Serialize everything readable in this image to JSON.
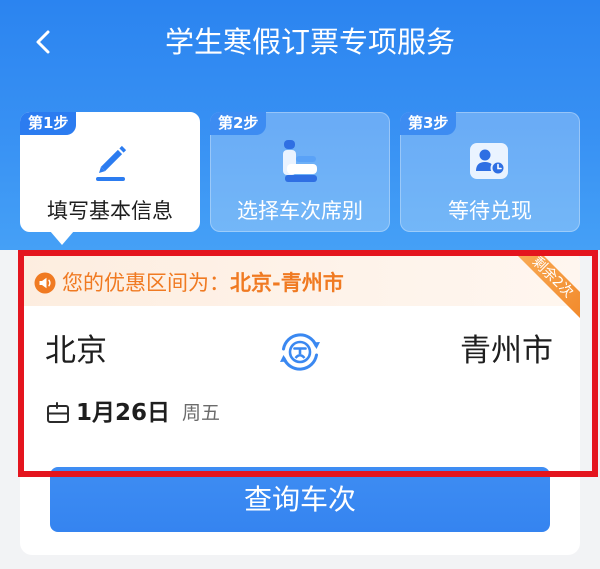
{
  "header": {
    "title": "学生寒假订票专项服务",
    "back_icon": "chevron-left-icon"
  },
  "steps": [
    {
      "badge": "第1步",
      "label": "填写基本信息",
      "icon": "pen-icon",
      "active": true
    },
    {
      "badge": "第2步",
      "label": "选择车次席别",
      "icon": "seat-icon",
      "active": false
    },
    {
      "badge": "第3步",
      "label": "等待兑现",
      "icon": "ticket-user-icon",
      "active": false
    }
  ],
  "booking": {
    "notice_icon": "megaphone-icon",
    "notice_prefix": "您的优惠区间为：",
    "notice_route": "北京-青州市",
    "ribbon": "剩余2次",
    "from_station": "北京",
    "to_station": "青州市",
    "swap_icon": "swap-stations-icon",
    "date_icon": "calendar-icon",
    "date": "1月26日",
    "weekday": "周五"
  },
  "search_button": {
    "label": "查询车次"
  },
  "colors": {
    "header_blue": "#2b84f0",
    "primary_blue": "#3a88f1",
    "notice_orange": "#f07a22",
    "ribbon_orange": "#f6993e",
    "highlight_red": "#e4151e"
  }
}
